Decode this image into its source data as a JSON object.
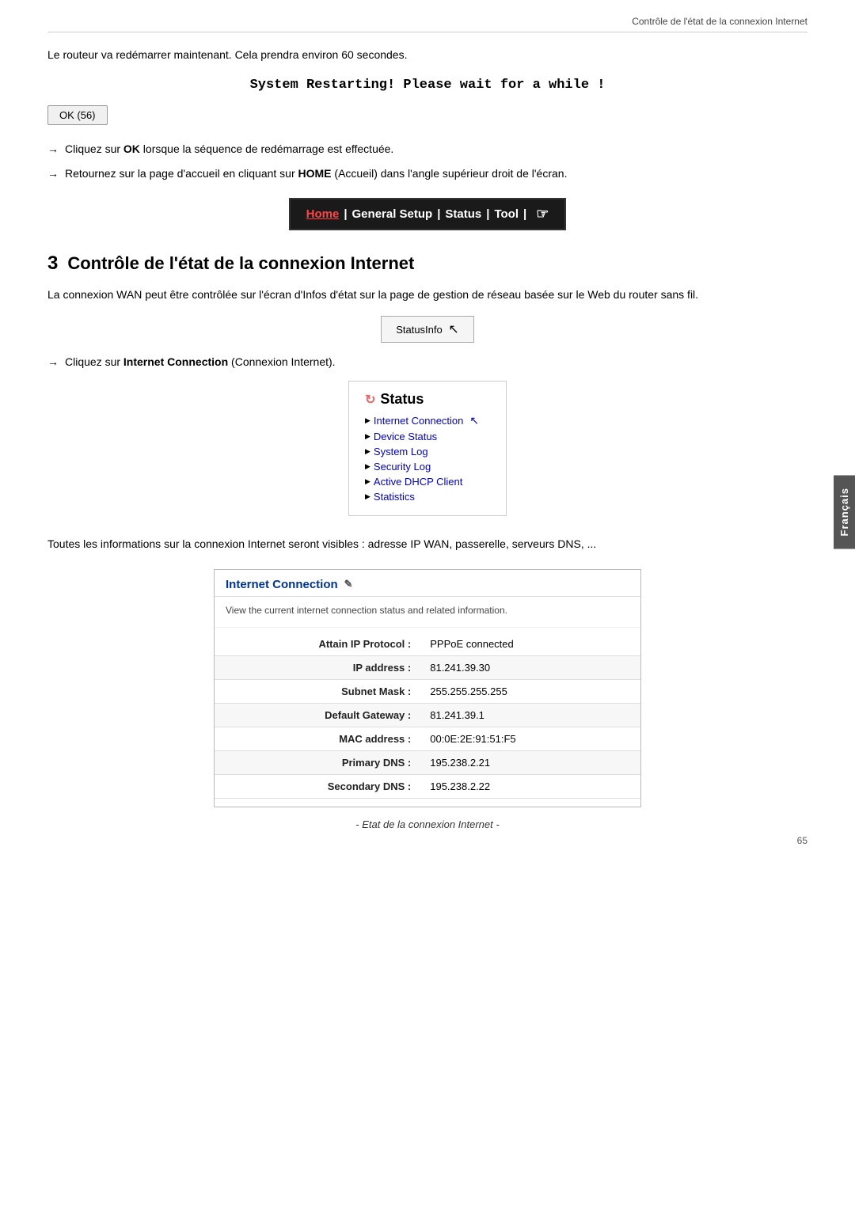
{
  "header": {
    "top_right": "Contrôle de l'état de la connexion Internet"
  },
  "intro": {
    "text": "Le routeur va redémarrer maintenant. Cela prendra environ 60 secondes."
  },
  "restarting": {
    "title": "System Restarting! Please wait for a while !"
  },
  "ok_button": {
    "label": "OK (56)"
  },
  "bullets": [
    {
      "text_before": "Cliquez sur ",
      "bold": "OK",
      "text_after": " lorsque la séquence de redémarrage est effectuée."
    },
    {
      "text_before": "Retournez sur la page d'accueil en cliquant sur ",
      "bold": "HOME",
      "text_after": " (Accueil) dans l'angle supérieur droit de l'écran."
    }
  ],
  "nav_bar": {
    "home": "Home",
    "items": "General Setup | Status | Tool |"
  },
  "section": {
    "number": "3",
    "title": "Contrôle de l'état de la connexion Internet",
    "body": "La connexion WAN peut être contrôlée sur l'écran d'Infos d'état sur la page de gestion de réseau basée sur le Web du router sans fil."
  },
  "status_info_button": {
    "label": "StatusInfo"
  },
  "click_instruction": {
    "text_before": "Cliquez sur ",
    "bold": "Internet Connection",
    "text_after": " (Connexion Internet)."
  },
  "status_menu": {
    "title": "Status",
    "items": [
      "Internet Connection",
      "Device Status",
      "System Log",
      "Security Log",
      "Active DHCP Client",
      "Statistics"
    ]
  },
  "info_text": "Toutes les informations sur la connexion Internet seront visibles : adresse IP WAN, passerelle, serveurs DNS, ...",
  "internet_connection": {
    "title": "Internet Connection",
    "description": "View the current internet connection status and related information.",
    "rows": [
      {
        "label": "Attain IP Protocol :",
        "value": "PPPoE connected"
      },
      {
        "label": "IP address :",
        "value": "81.241.39.30"
      },
      {
        "label": "Subnet Mask :",
        "value": "255.255.255.255"
      },
      {
        "label": "Default Gateway :",
        "value": "81.241.39.1"
      },
      {
        "label": "MAC address :",
        "value": "00:0E:2E:91:51:F5"
      },
      {
        "label": "Primary DNS :",
        "value": "195.238.2.21"
      },
      {
        "label": "Secondary DNS :",
        "value": "195.238.2.22"
      }
    ],
    "caption": "- Etat de la connexion Internet -"
  },
  "side_tab": {
    "label": "Français"
  },
  "page_number": "65"
}
